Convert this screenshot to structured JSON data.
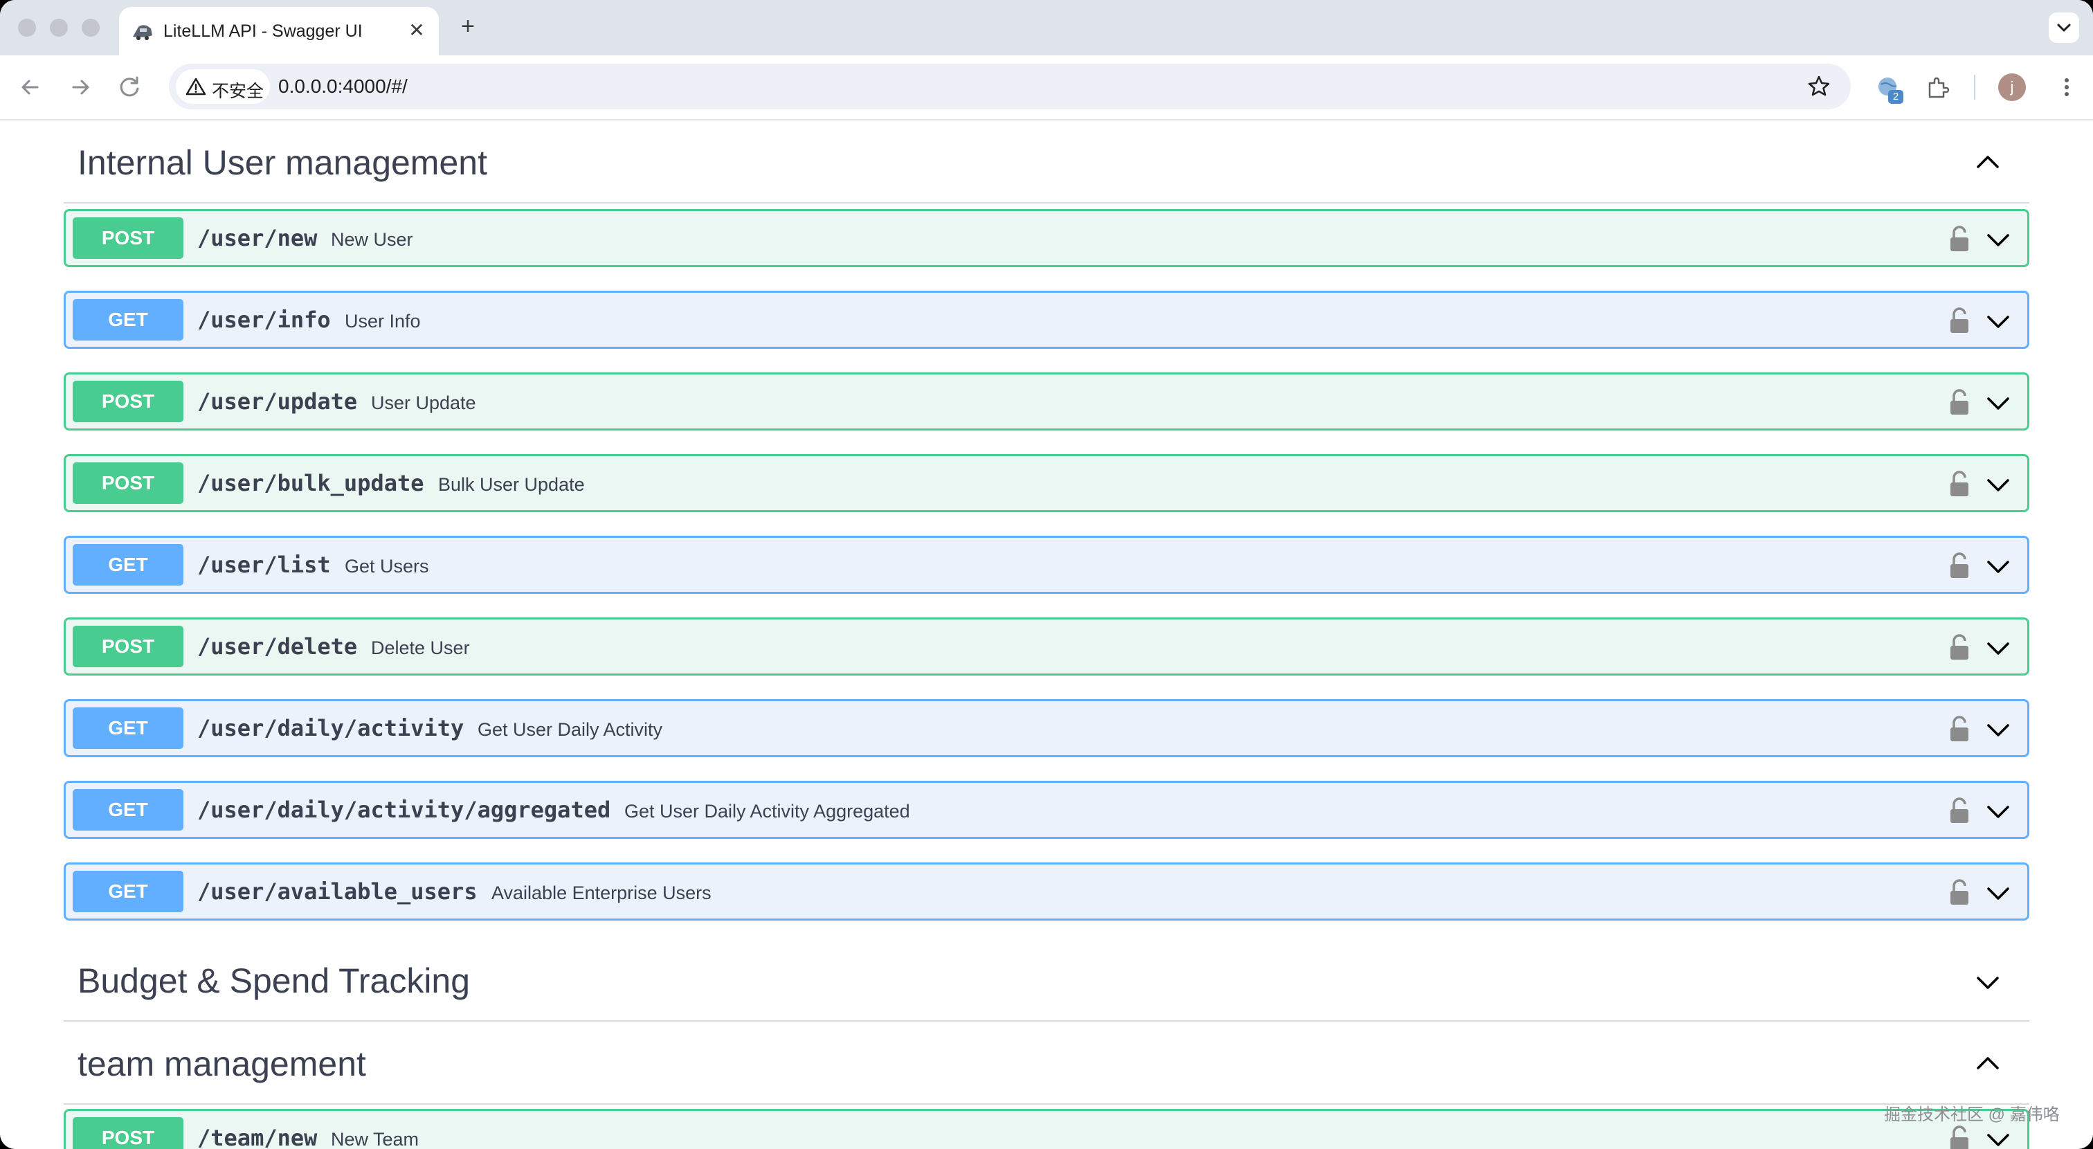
{
  "browser": {
    "tab_title": "LiteLLM API - Swagger UI",
    "tab_close_glyph": "✕",
    "new_tab_glyph": "+",
    "security_label": "不安全",
    "url": "0.0.0.0:4000/#/",
    "extension_badge": "2",
    "profile_initial": "j"
  },
  "sections": [
    {
      "title": "Internal User management",
      "expanded": true,
      "operations": [
        {
          "method": "POST",
          "path": "/user/new",
          "summary": "New User"
        },
        {
          "method": "GET",
          "path": "/user/info",
          "summary": "User Info"
        },
        {
          "method": "POST",
          "path": "/user/update",
          "summary": "User Update"
        },
        {
          "method": "POST",
          "path": "/user/bulk_update",
          "summary": "Bulk User Update"
        },
        {
          "method": "GET",
          "path": "/user/list",
          "summary": "Get Users"
        },
        {
          "method": "POST",
          "path": "/user/delete",
          "summary": "Delete User"
        },
        {
          "method": "GET",
          "path": "/user/daily/activity",
          "summary": "Get User Daily Activity"
        },
        {
          "method": "GET",
          "path": "/user/daily/activity/aggregated",
          "summary": "Get User Daily Activity Aggregated"
        },
        {
          "method": "GET",
          "path": "/user/available_users",
          "summary": "Available Enterprise Users"
        }
      ]
    },
    {
      "title": "Budget & Spend Tracking",
      "expanded": false,
      "operations": []
    },
    {
      "title": "team management",
      "expanded": true,
      "operations": [
        {
          "method": "POST",
          "path": "/team/new",
          "summary": "New Team"
        }
      ]
    }
  ],
  "watermark": "掘金技术社区 @ 嘉伟咯",
  "colors": {
    "post": "#49cc90",
    "get": "#61affe",
    "text": "#3b4151"
  }
}
